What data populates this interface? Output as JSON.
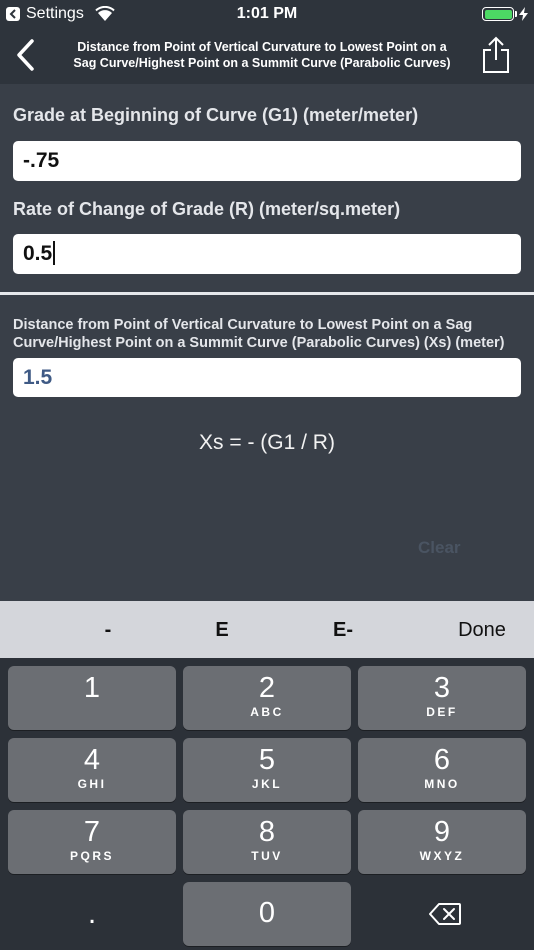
{
  "status_bar": {
    "back_app": "Settings",
    "time": "1:01 PM"
  },
  "nav": {
    "title_line1": "Distance from Point of Vertical Curvature to Lowest Point on a",
    "title_line2": "Sag Curve/Highest Point on a Summit Curve (Parabolic Curves)"
  },
  "form": {
    "g1_label": "Grade at Beginning of Curve (G1) (meter/meter)",
    "g1_value": "-.75",
    "r_label": "Rate of Change of Grade (R) (meter/sq.meter)",
    "r_value": "0.5"
  },
  "result": {
    "label": "Distance from Point of Vertical Curvature to Lowest Point on a Sag Curve/Highest Point on a Summit Curve (Parabolic Curves) (Xs) (meter)",
    "value": "1.5"
  },
  "formula": "Xs = - (G1 / R)",
  "clear_label": "Clear",
  "accessory": {
    "minus": "-",
    "e": "E",
    "e_minus": "E-",
    "done": "Done"
  },
  "keypad": {
    "k1": {
      "num": "1",
      "letters": ""
    },
    "k2": {
      "num": "2",
      "letters": "ABC"
    },
    "k3": {
      "num": "3",
      "letters": "DEF"
    },
    "k4": {
      "num": "4",
      "letters": "GHI"
    },
    "k5": {
      "num": "5",
      "letters": "JKL"
    },
    "k6": {
      "num": "6",
      "letters": "MNO"
    },
    "k7": {
      "num": "7",
      "letters": "PQRS"
    },
    "k8": {
      "num": "8",
      "letters": "TUV"
    },
    "k9": {
      "num": "9",
      "letters": "WXYZ"
    },
    "k0": {
      "num": "0"
    },
    "decimal": "."
  },
  "colors": {
    "background": "#393f48",
    "bar": "#2e343c",
    "result_text": "#3f5a85",
    "battery": "#4cd964"
  },
  "icons": {
    "back": "chevron-left-icon",
    "share": "share-icon",
    "delete": "backspace-icon",
    "wifi": "wifi-icon",
    "battery": "battery-icon",
    "charging": "bolt-icon"
  }
}
